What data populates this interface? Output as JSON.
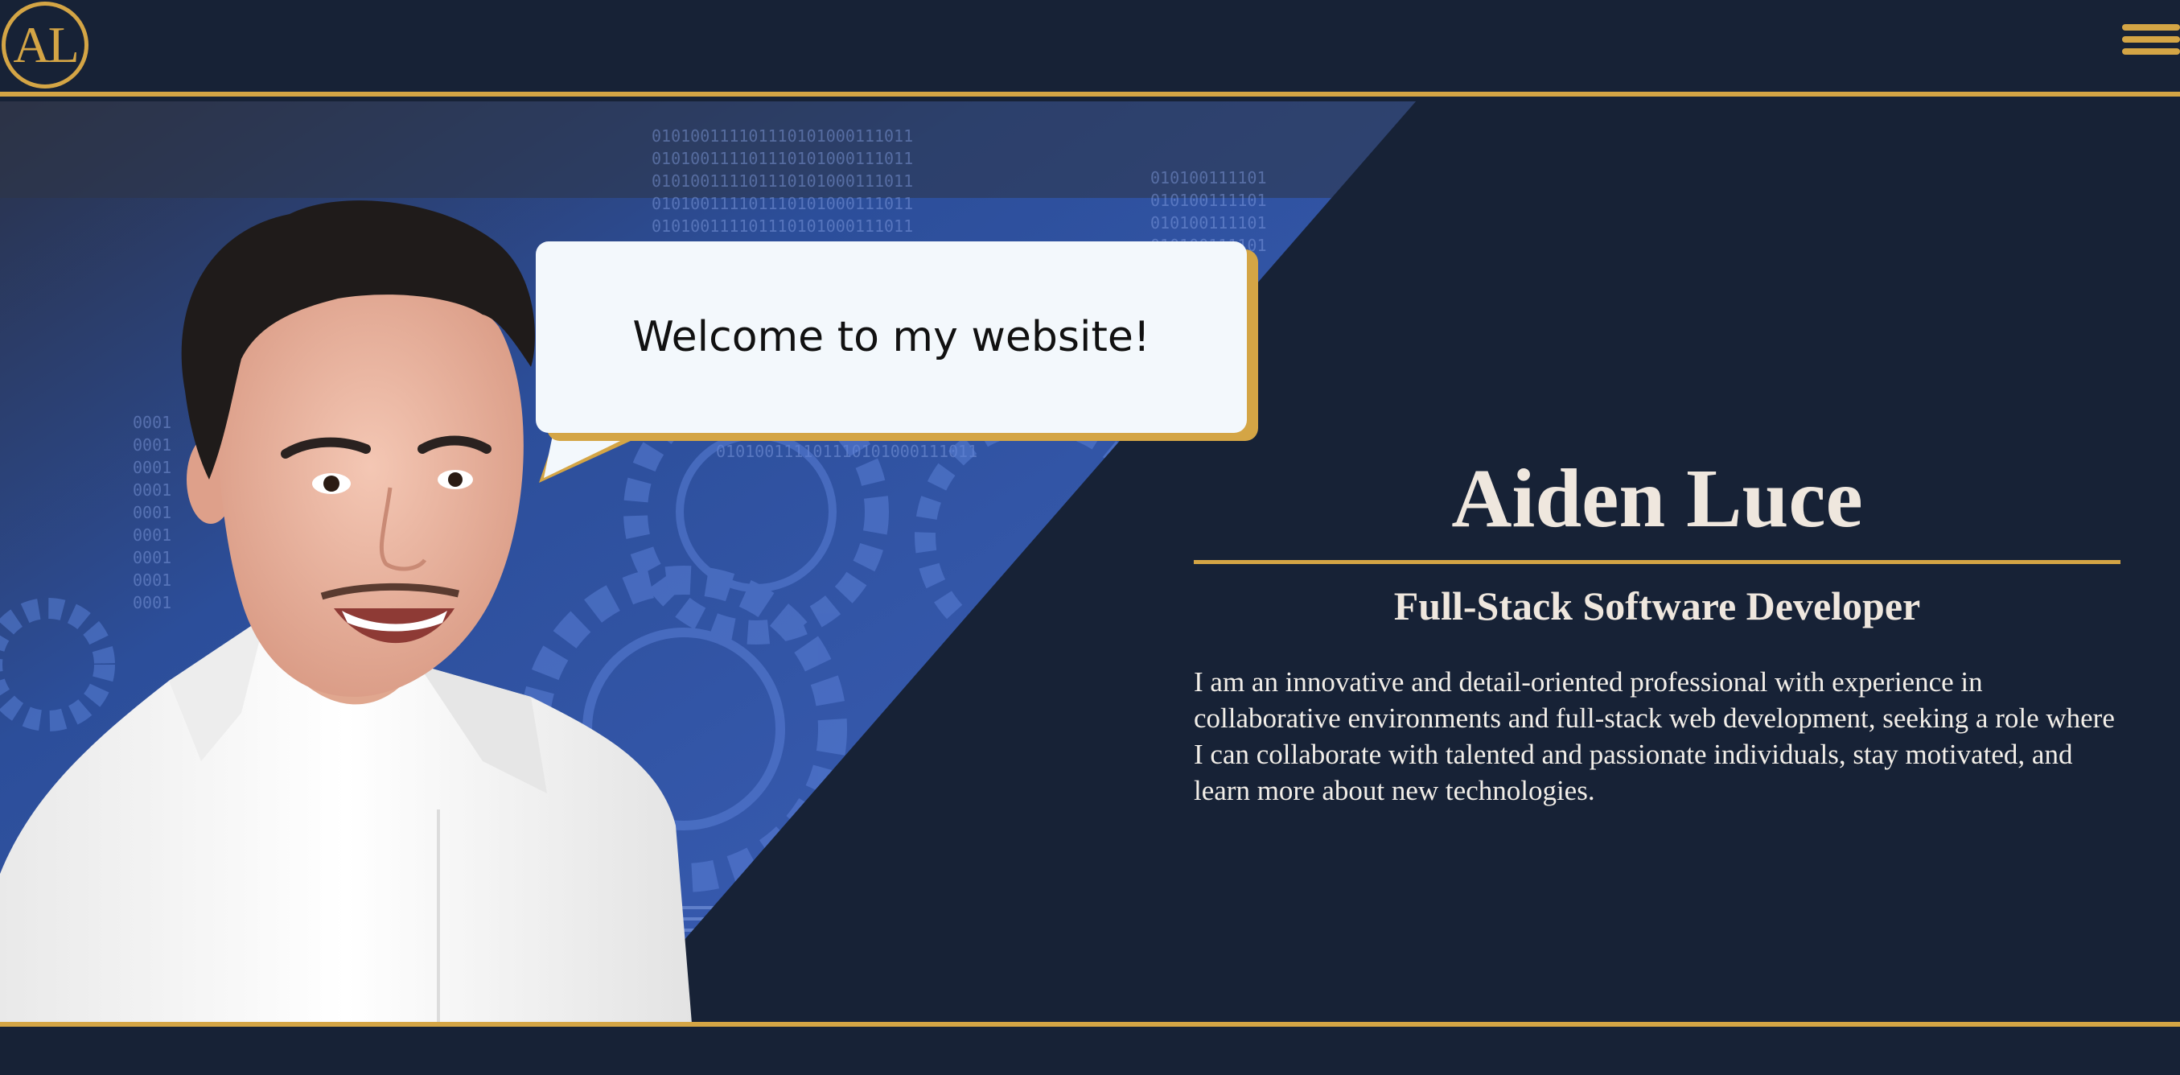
{
  "header": {
    "logo_text": "AL",
    "menu_icon": "hamburger-menu-icon"
  },
  "speech_bubble": {
    "text": "Welcome to my website!"
  },
  "profile": {
    "name": "Aiden Luce",
    "title": "Full-Stack Software Developer",
    "bio": "I am an innovative and detail-oriented professional with experience in collaborative environments and full-stack web development, seeking a role where I can collaborate with talented and passionate individuals, stay motivated, and learn more about new technologies."
  },
  "colors": {
    "background": "#172236",
    "accent": "#d4a545",
    "hero_blue": "#3b5db5",
    "text_light": "#efe7de"
  }
}
